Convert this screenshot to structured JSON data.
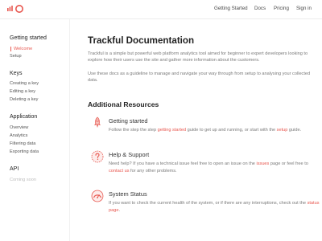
{
  "topbar": {
    "logo_icon": "trackful-logo-icon",
    "nav": [
      "Getting Started",
      "Docs",
      "Pricing",
      "Sign in"
    ]
  },
  "sidebar": {
    "groups": [
      {
        "title": "Getting started",
        "items": [
          "Welcome",
          "Setup"
        ]
      },
      {
        "title": "Keys",
        "items": [
          "Creating a key",
          "Editing a key",
          "Deleting a key"
        ]
      },
      {
        "title": "Application",
        "items": [
          "Overview",
          "Analytics",
          "Filtering data",
          "Exporting data"
        ]
      },
      {
        "title": "API",
        "items": [
          "Coming soon"
        ]
      }
    ]
  },
  "main": {
    "title": "Trackful Documentation",
    "intro": "Trackful is a simple but powerful web platform analytics tool aimed for beginner to expert developers looking to explore how their users use the site and gather more information about the customers.",
    "guide": "Use these docs as a guideline to manage and navigate your way through from setup to analysing your collected data.",
    "resources_title": "Additional Resources",
    "resources": [
      {
        "icon": "rocket-icon",
        "title": "Getting started",
        "text1": "Follow the step the step ",
        "link1": "getting started",
        "text2": " guide to get up and running, or start with the ",
        "link2": "setup",
        "text3": " guide."
      },
      {
        "icon": "help-icon",
        "title": "Help & Support",
        "text1": "Need help? If you have a technical issue feel free to open an issue on the ",
        "link1": "issues",
        "text2": " page or feel free to ",
        "link2": "contact us",
        "text3": " for any other problems."
      },
      {
        "icon": "status-gauge-icon",
        "title": "System Status",
        "text1": "If you want to check the current health of the system, or if there are any interruptions, check out the ",
        "link1": "status page",
        "text2": "."
      }
    ]
  },
  "colors": {
    "accent": "#e8574f",
    "heading": "#222222",
    "body_text": "#7a7a7a"
  }
}
